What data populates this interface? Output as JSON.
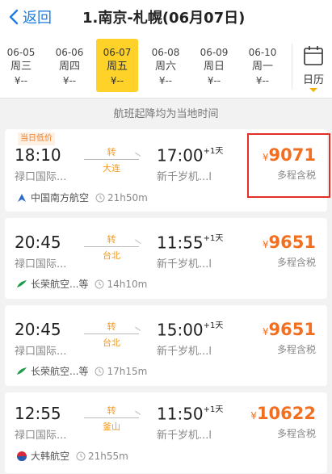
{
  "header": {
    "back_label": "返回",
    "title": "1.南京-札幌(06月07日)"
  },
  "dates": [
    {
      "date": "06-05",
      "weekday": "周三",
      "price": "¥--"
    },
    {
      "date": "06-06",
      "weekday": "周四",
      "price": "¥--"
    },
    {
      "date": "06-07",
      "weekday": "周五",
      "price": "¥--"
    },
    {
      "date": "06-08",
      "weekday": "周六",
      "price": "¥--"
    },
    {
      "date": "06-09",
      "weekday": "周日",
      "price": "¥--"
    },
    {
      "date": "06-10",
      "weekday": "周一",
      "price": "¥--"
    }
  ],
  "calendar_label": "日历",
  "notice": "航班起降均为当地时间",
  "flights": [
    {
      "tag": "当日低价",
      "dep_time": "18:10",
      "dep_airport": "禄口国际...",
      "transfer": "转",
      "via": "大连",
      "arr_time": "17:00",
      "arr_day": "+1天",
      "arr_airport": "新千岁机...l",
      "currency": "¥",
      "price": "9071",
      "price_note": "多程含税",
      "airline": "中国南方航空",
      "duration": "21h50m",
      "logo": "china-southern-logo",
      "logo_color": "#2c6bc4"
    },
    {
      "tag": "",
      "dep_time": "20:45",
      "dep_airport": "禄口国际...",
      "transfer": "转",
      "via": "台北",
      "arr_time": "11:55",
      "arr_day": "+1天",
      "arr_airport": "新千岁机...l",
      "currency": "¥",
      "price": "9651",
      "price_note": "多程含税",
      "airline": "长荣航空...等",
      "duration": "14h10m",
      "logo": "eva-air-logo",
      "logo_color": "#1e9a4a"
    },
    {
      "tag": "",
      "dep_time": "20:45",
      "dep_airport": "禄口国际...",
      "transfer": "转",
      "via": "台北",
      "arr_time": "15:00",
      "arr_day": "+1天",
      "arr_airport": "新千岁机...l",
      "currency": "¥",
      "price": "9651",
      "price_note": "多程含税",
      "airline": "长荣航空...等",
      "duration": "17h15m",
      "logo": "eva-air-logo",
      "logo_color": "#1e9a4a"
    },
    {
      "tag": "",
      "dep_time": "12:55",
      "dep_airport": "禄口国际...",
      "transfer": "转",
      "via": "釜山",
      "arr_time": "11:50",
      "arr_day": "+1天",
      "arr_airport": "新千岁机...l",
      "currency": "¥",
      "price": "10622",
      "price_note": "多程含税",
      "airline": "大韩航空",
      "duration": "21h55m",
      "logo": "korean-air-logo",
      "logo_color": "#d8283a"
    }
  ],
  "colors": {
    "accent_blue": "#1e7de0",
    "price_orange": "#f36f20",
    "selected_date": "#ffd22a",
    "highlight_red": "#e23028"
  }
}
